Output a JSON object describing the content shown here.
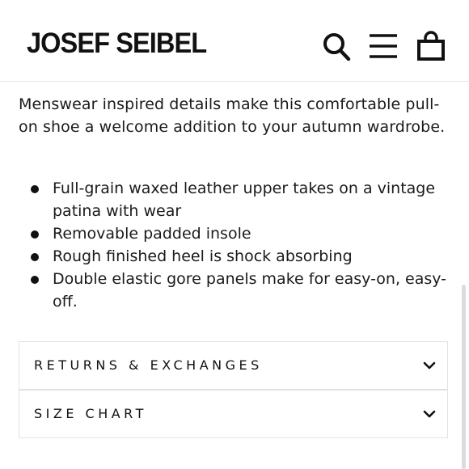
{
  "header": {
    "logo_text": "JOSEF SEIBEL",
    "icons": [
      "search-icon",
      "hamburger-menu-icon",
      "shopping-bag-icon"
    ]
  },
  "product": {
    "description": "Menswear inspired details make this comfortable pull-on shoe a welcome addition to your autumn wardrobe.",
    "features": [
      "Full-grain waxed leather upper takes on a vintage patina with wear",
      "Removable padded insole",
      "Rough finished heel is shock absorbing",
      "Double elastic gore panels make for easy-on, easy-off."
    ]
  },
  "accordions": [
    {
      "label": "RETURNS & EXCHANGES",
      "icon": "chevron-down-icon"
    },
    {
      "label": "SIZE CHART",
      "icon": "chevron-down-icon"
    }
  ],
  "colors": {
    "text": "#111111",
    "border": "#e2e2e2",
    "background": "#ffffff"
  }
}
